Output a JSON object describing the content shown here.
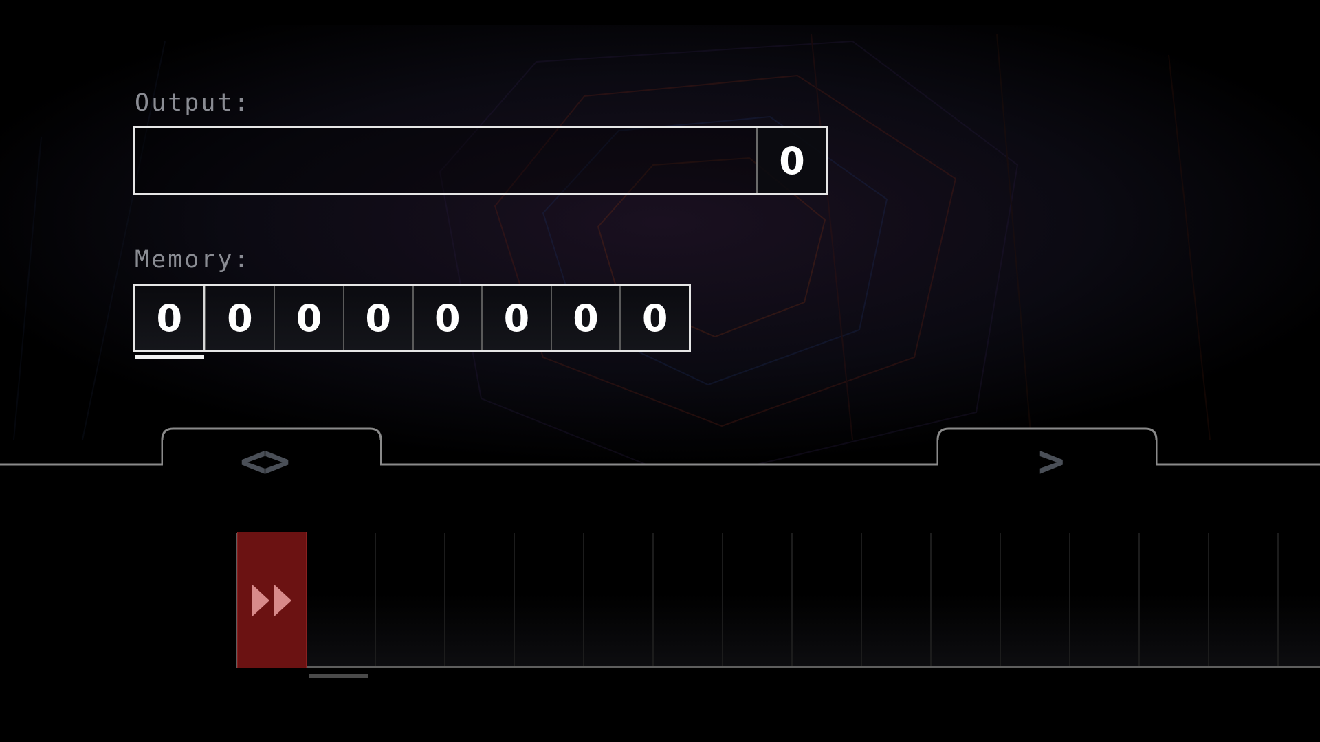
{
  "output": {
    "label": "Output:",
    "value": "0"
  },
  "memory": {
    "label": "Memory:",
    "cells": [
      "0",
      "0",
      "0",
      "0",
      "0",
      "0",
      "0",
      "0"
    ],
    "pointer_index": 0
  },
  "tabs": {
    "left_icon": "<>",
    "right_icon": ">"
  },
  "program": {
    "cells": [
      "fast-forward",
      "",
      "",
      "",
      "",
      "",
      "",
      "",
      "",
      "",
      "",
      "",
      "",
      "",
      "",
      ""
    ],
    "pointer_index": 1
  },
  "colors": {
    "command_cell": "#6b1212",
    "command_icon": "#d88a8a",
    "text_label": "#8a8c93",
    "tab_icon": "#4a4f57"
  }
}
